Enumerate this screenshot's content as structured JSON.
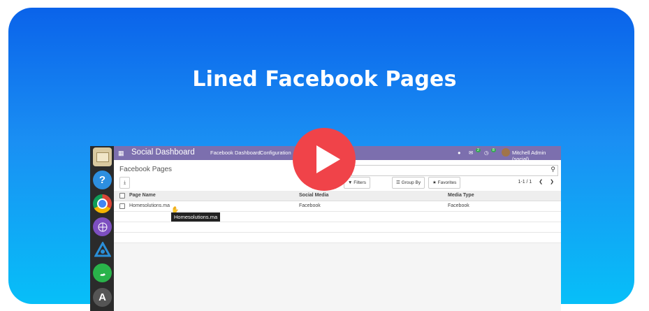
{
  "banner": {
    "title": "Lined Facebook Pages",
    "play_icon": "play-icon"
  },
  "navbar": {
    "brand": "Social Dashboard",
    "menu": [
      "Facebook Dashboard",
      "Configuration"
    ],
    "user": "Mitchell Admin (social)",
    "chat_count": "2",
    "activity_count": "8"
  },
  "control_panel": {
    "breadcrumb": "Facebook Pages",
    "filters_label": "Filters",
    "group_by_label": "Group By",
    "favorites_label": "Favorites",
    "pager": "1-1 / 1"
  },
  "table": {
    "headers": [
      "Page Name",
      "Social Media",
      "Media Type"
    ],
    "rows": [
      {
        "page_name": "Homesolutions.ma",
        "social_media": "Facebook",
        "media_type": "Facebook"
      }
    ]
  },
  "tooltip": "Homesolutions.ma",
  "dock": [
    "files-icon",
    "help-icon",
    "chrome-icon",
    "network-icon",
    "app-icon",
    "whatsapp-icon",
    "anydesk-icon"
  ],
  "colors": {
    "navbar": "#7c6fae",
    "play": "#f04349",
    "gradient_top": "#0a63ea",
    "gradient_bottom": "#07bff8"
  }
}
